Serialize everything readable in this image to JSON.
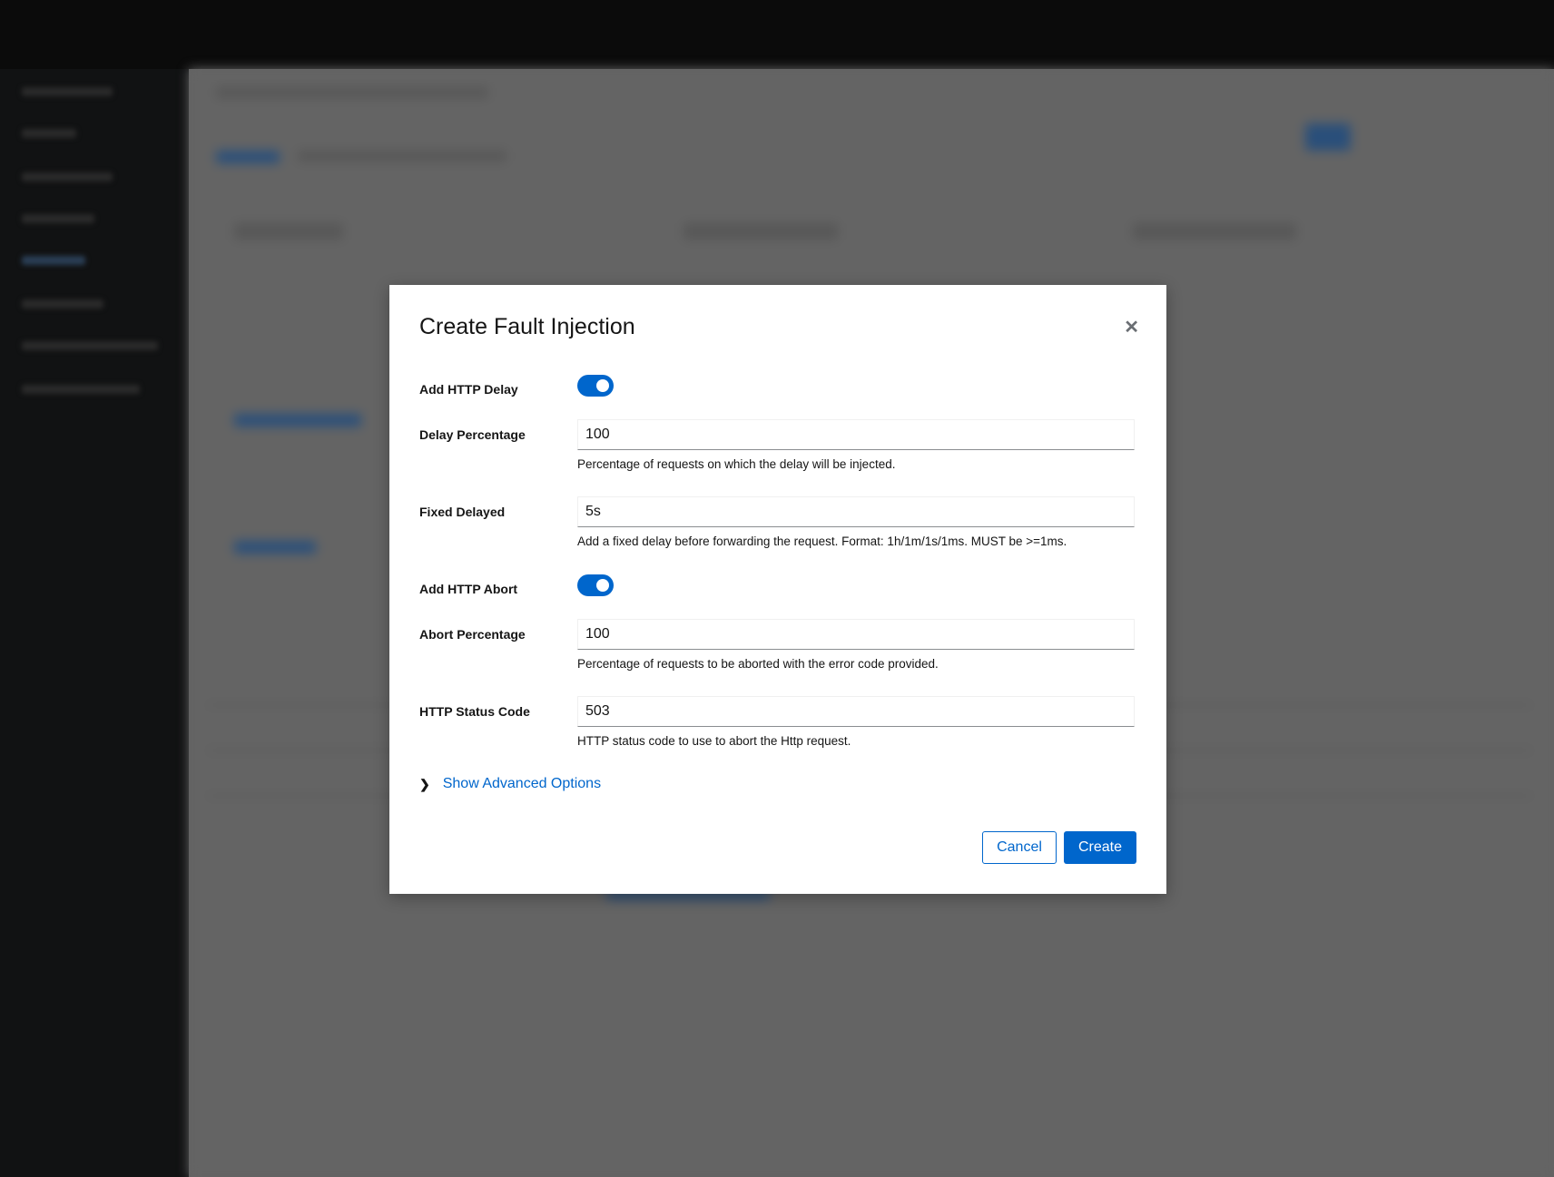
{
  "modal": {
    "title": "Create Fault Injection",
    "close_icon": "close-icon",
    "fields": [
      {
        "label": "Add HTTP Delay",
        "type": "toggle",
        "checked": true
      },
      {
        "label": "Delay Percentage",
        "value": "100",
        "help": "Percentage of requests on which the delay will be injected."
      },
      {
        "label": "Fixed Delayed",
        "value": "5s",
        "help": "Add a fixed delay before forwarding the request. Format: 1h/1m/1s/1ms. MUST be >=1ms."
      },
      {
        "label": "Add HTTP Abort",
        "type": "toggle",
        "checked": true
      },
      {
        "label": "Abort Percentage",
        "value": "100",
        "help": "Percentage of requests to be aborted with the error code provided."
      },
      {
        "label": "HTTP Status Code",
        "value": "503",
        "help": "HTTP status code to use to abort the Http request."
      }
    ],
    "advanced_label": "Show Advanced Options",
    "cancel_label": "Cancel",
    "create_label": "Create"
  },
  "colors": {
    "primary": "#0066cc",
    "overlay": "#636363"
  }
}
